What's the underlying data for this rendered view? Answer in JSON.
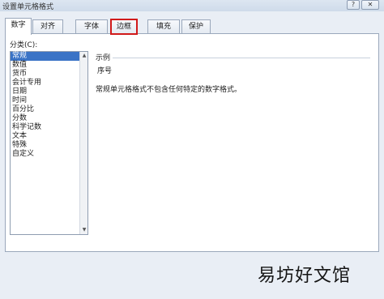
{
  "window": {
    "title": "设置单元格格式",
    "help_label": "?",
    "close_label": "✕"
  },
  "tabs": [
    {
      "label": "数字",
      "active": true
    },
    {
      "label": "对齐"
    },
    {
      "label": "字体"
    },
    {
      "label": "边框",
      "highlighted": true,
      "highlight_color": "#d11a1a"
    },
    {
      "label": "填充"
    },
    {
      "label": "保护"
    }
  ],
  "category": {
    "label": "分类(C):",
    "items": [
      "常规",
      "数值",
      "货币",
      "会计专用",
      "日期",
      "时间",
      "百分比",
      "分数",
      "科学记数",
      "文本",
      "特殊",
      "自定义"
    ],
    "selected": "常规",
    "selected_color": "#3a73c6"
  },
  "sample": {
    "label": "示例",
    "value": "序号"
  },
  "description": "常规单元格格式不包含任何特定的数字格式。",
  "watermark": "易坊好文馆",
  "icons": {
    "scroll_up": "▲",
    "scroll_down": "▼"
  }
}
